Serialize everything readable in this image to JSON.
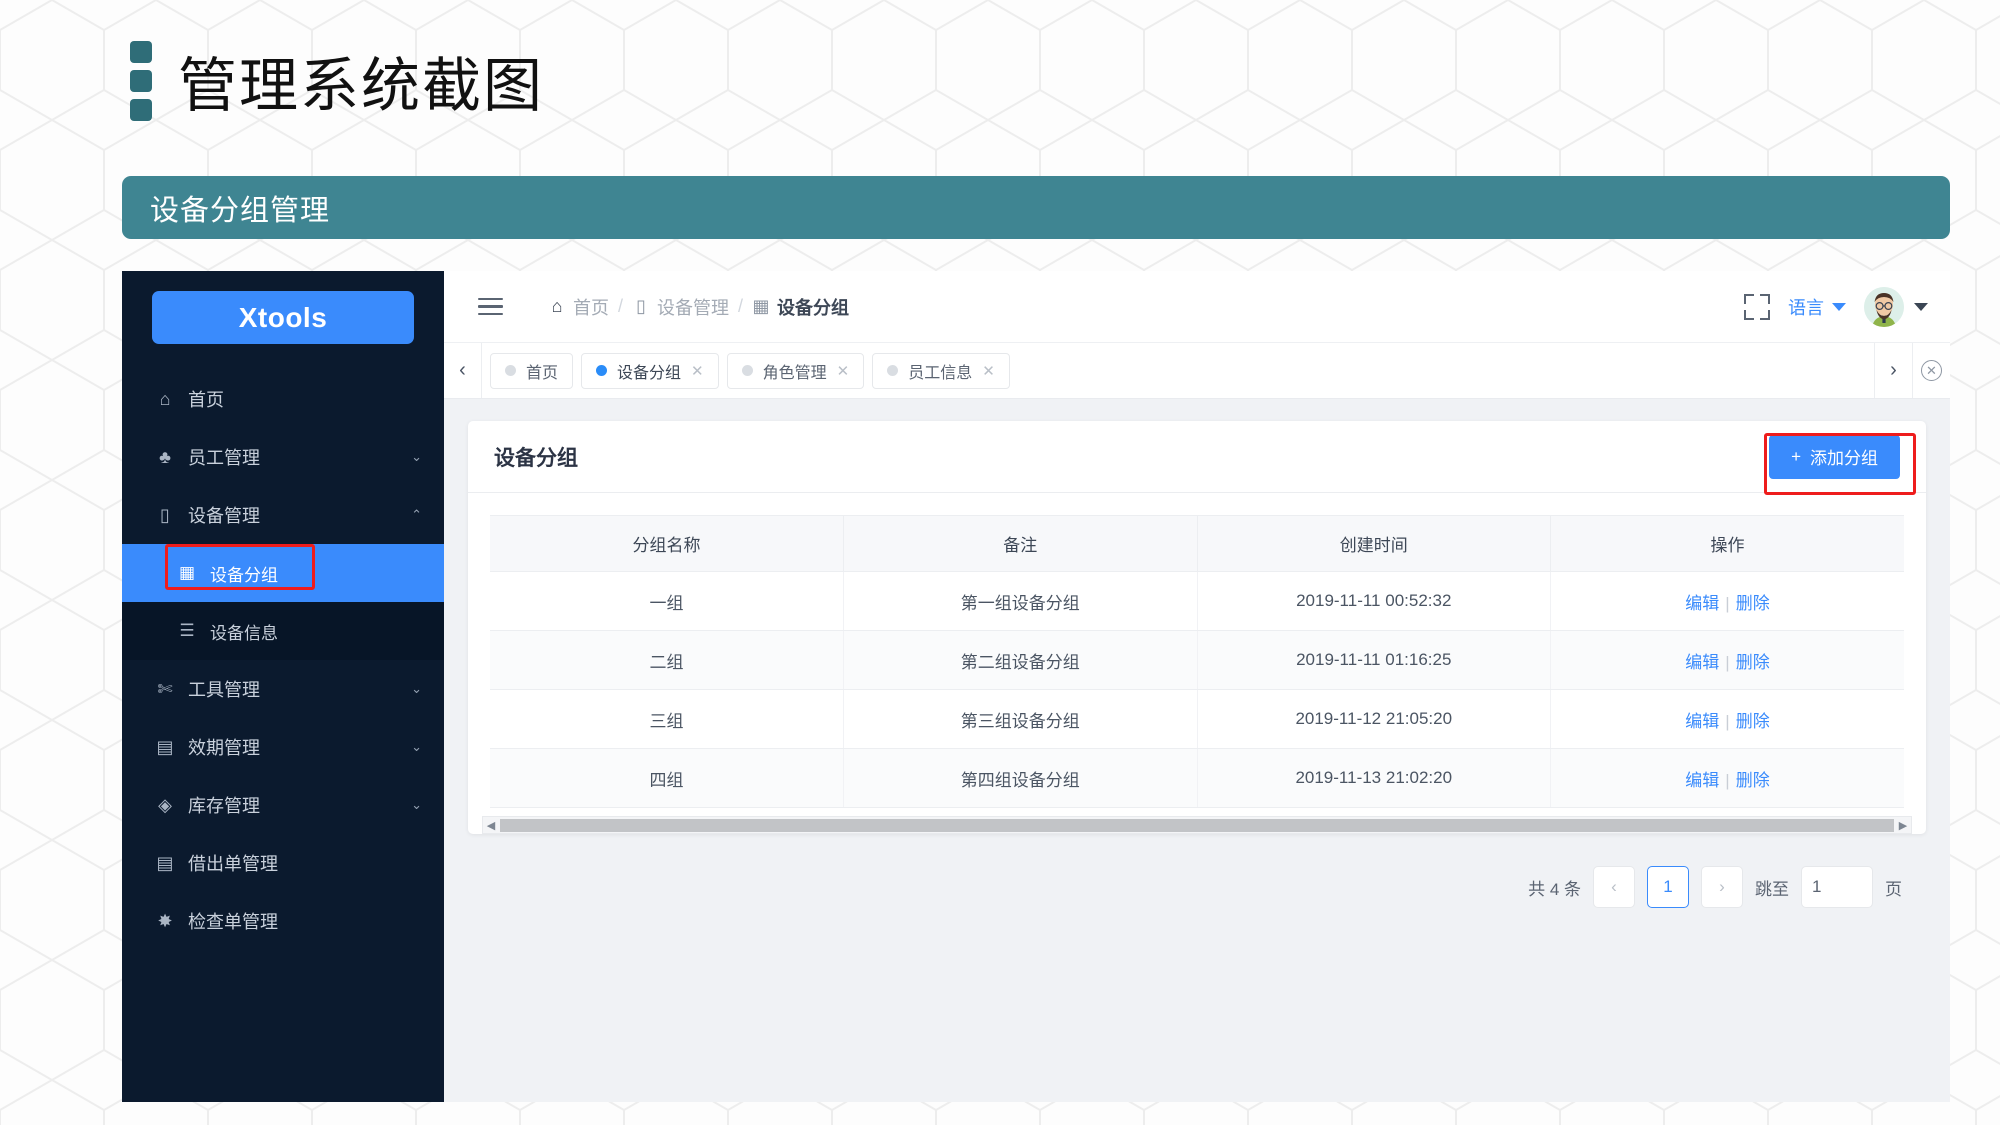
{
  "slide": {
    "title": "管理系统截图",
    "banner": "设备分组管理",
    "accent_teal": "#3f8592",
    "accent_blue": "#3a8bfc",
    "highlight_red": "#ee1c1c"
  },
  "sidebar": {
    "logo": "Xtools",
    "items": [
      {
        "label": "首页",
        "icon": "home-icon",
        "chevron": "",
        "level": "top",
        "active": false
      },
      {
        "label": "员工管理",
        "icon": "users-icon",
        "chevron": "⌄",
        "level": "top",
        "active": false
      },
      {
        "label": "设备管理",
        "icon": "device-icon",
        "chevron": "⌃",
        "level": "top",
        "active": false
      },
      {
        "label": "设备分组",
        "icon": "grid-icon",
        "chevron": "",
        "level": "sub",
        "active": true
      },
      {
        "label": "设备信息",
        "icon": "list-icon",
        "chevron": "",
        "level": "sub",
        "active": false
      },
      {
        "label": "工具管理",
        "icon": "wrench-icon",
        "chevron": "⌄",
        "level": "top",
        "active": false
      },
      {
        "label": "效期管理",
        "icon": "document-icon",
        "chevron": "⌄",
        "level": "top",
        "active": false
      },
      {
        "label": "库存管理",
        "icon": "layers-icon",
        "chevron": "⌄",
        "level": "top",
        "active": false
      },
      {
        "label": "借出单管理",
        "icon": "document-icon",
        "chevron": "",
        "level": "top",
        "active": false
      },
      {
        "label": "检查单管理",
        "icon": "bug-icon",
        "chevron": "",
        "level": "top",
        "active": false
      }
    ]
  },
  "topbar": {
    "menu_icon": "hamburger-icon",
    "breadcrumb": [
      {
        "label": "首页",
        "icon": "home-icon"
      },
      {
        "label": "设备管理",
        "icon": "device-icon"
      },
      {
        "label": "设备分组",
        "icon": "grid-icon"
      }
    ],
    "separator": "/",
    "fullscreen_icon": "fullscreen-icon",
    "language_label": "语言",
    "avatar_icon": "user-avatar"
  },
  "tabstrip": {
    "prev_icon": "chevron-left-icon",
    "next_icon": "chevron-right-icon",
    "close_all_icon": "circle-close-icon",
    "tabs": [
      {
        "label": "首页",
        "active": false,
        "closable": false
      },
      {
        "label": "设备分组",
        "active": true,
        "closable": true
      },
      {
        "label": "角色管理",
        "active": false,
        "closable": true
      },
      {
        "label": "员工信息",
        "active": false,
        "closable": true
      }
    ]
  },
  "card": {
    "title": "设备分组",
    "add_button": {
      "icon": "plus-icon",
      "label": "添加分组"
    }
  },
  "table": {
    "columns": [
      "分组名称",
      "备注",
      "创建时间",
      "操作"
    ],
    "rows": [
      {
        "name": "一组",
        "remark": "第一组设备分组",
        "created": "2019-11-11 00:52:32",
        "edit": "编辑",
        "sep": "|",
        "delete": "删除"
      },
      {
        "name": "二组",
        "remark": "第二组设备分组",
        "created": "2019-11-11 01:16:25",
        "edit": "编辑",
        "sep": "|",
        "delete": "删除"
      },
      {
        "name": "三组",
        "remark": "第三组设备分组",
        "created": "2019-11-12 21:05:20",
        "edit": "编辑",
        "sep": "|",
        "delete": "删除"
      },
      {
        "name": "四组",
        "remark": "第四组设备分组",
        "created": "2019-11-13 21:02:20",
        "edit": "编辑",
        "sep": "|",
        "delete": "删除"
      }
    ]
  },
  "pager": {
    "total_text": "共 4 条",
    "prev": "‹",
    "current_page": "1",
    "next": "›",
    "jump_label": "跳至",
    "jump_value": "1",
    "page_unit": "页"
  }
}
